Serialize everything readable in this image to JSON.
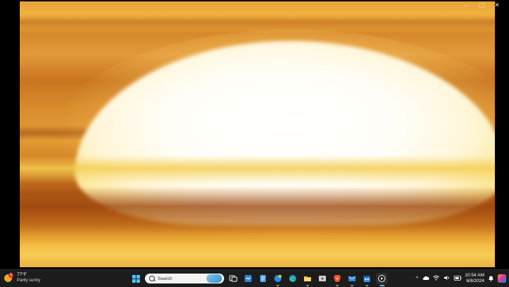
{
  "window": {
    "controls": {
      "minimize": "–",
      "maximize": "▢",
      "close": "✕"
    }
  },
  "video": {
    "description_colors": {
      "sky": "#e39c33",
      "sun": "#ffffff",
      "dark_band": "#9c4510"
    }
  },
  "taskbar": {
    "weather": {
      "temperature": "77°F",
      "condition": "Partly sunny",
      "badge": "1"
    },
    "search": {
      "placeholder": "Search"
    },
    "pinned": [
      {
        "name": "task-view-icon"
      },
      {
        "name": "widgets-icon"
      },
      {
        "name": "notepad-icon"
      },
      {
        "name": "phone-link-icon"
      },
      {
        "name": "edge-icon"
      },
      {
        "name": "file-explorer-icon"
      },
      {
        "name": "media-app-icon"
      },
      {
        "name": "brave-icon"
      },
      {
        "name": "mail-icon"
      },
      {
        "name": "calendar-icon"
      },
      {
        "name": "media-player-icon"
      }
    ],
    "tray": {
      "chevron": "^",
      "time": "10:54 AM",
      "date": "6/8/2024"
    },
    "accent": "#4cc2ff"
  }
}
